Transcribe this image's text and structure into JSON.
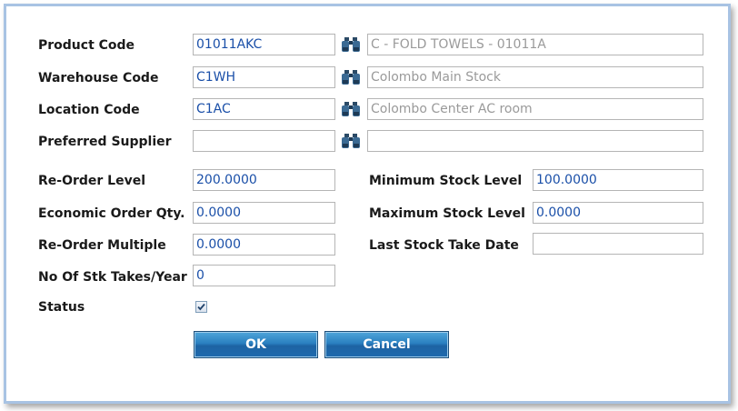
{
  "form": {
    "product_code": {
      "label": "Product Code",
      "value": "01011AKC",
      "description": "C - FOLD TOWELS - 01011A"
    },
    "warehouse_code": {
      "label": "Warehouse Code",
      "value": "C1WH",
      "description": "Colombo Main Stock"
    },
    "location_code": {
      "label": "Location Code",
      "value": "C1AC",
      "description": "Colombo Center AC room"
    },
    "preferred_supplier": {
      "label": "Preferred Supplier",
      "value": "",
      "description": ""
    },
    "reorder_level": {
      "label": "Re-Order Level",
      "value": "200.0000"
    },
    "economic_order_qty": {
      "label": "Economic Order Qty.",
      "value": "0.0000"
    },
    "reorder_multiple": {
      "label": "Re-Order Multiple",
      "value": "0.0000"
    },
    "stock_takes_per_year": {
      "label": "No Of Stk Takes/Year",
      "value": "0"
    },
    "status": {
      "label": "Status",
      "checked": true
    },
    "minimum_stock_level": {
      "label": "Minimum Stock Level",
      "value": "100.0000"
    },
    "maximum_stock_level": {
      "label": "Maximum Stock Level",
      "value": "0.0000"
    },
    "last_stock_take_date": {
      "label": "Last Stock Take Date",
      "value": ""
    }
  },
  "buttons": {
    "ok": "OK",
    "cancel": "Cancel"
  },
  "icons": {
    "lookup": "binoculars-icon",
    "checkbox": "checkmark-icon"
  },
  "colors": {
    "value_text": "#1a4fa8",
    "readonly_text": "#9a9a9a",
    "frame_border": "#a8c3e3",
    "button": "#2a7fc0"
  }
}
